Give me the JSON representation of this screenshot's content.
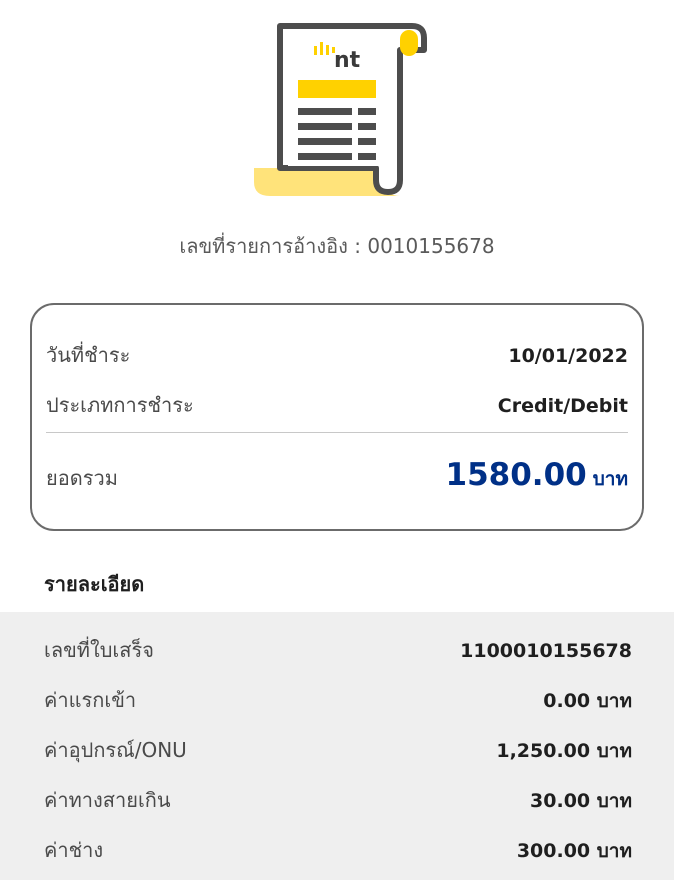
{
  "brand": {
    "logo_text": "nt"
  },
  "reference": {
    "text": "เลขที่รายการอ้างอิง : 0010155678"
  },
  "summary": {
    "payment_date_label": "วันที่ชำระ",
    "payment_date_value": "10/01/2022",
    "payment_type_label": "ประเภทการชำระ",
    "payment_type_value": "Credit/Debit",
    "total_label": "ยอดรวม",
    "total_value": "1580.00",
    "total_unit": "บาท"
  },
  "details": {
    "title": "รายละเอียด",
    "rows": [
      {
        "label": "เลขที่ใบเสร็จ",
        "value": "1100010155678"
      },
      {
        "label": "ค่าแรกเข้า",
        "value": "0.00 บาท"
      },
      {
        "label": "ค่าอุปกรณ์/ONU",
        "value": "1,250.00 บาท"
      },
      {
        "label": "ค่าทางสายเกิน",
        "value": "30.00 บาท"
      },
      {
        "label": "ค่าช่าง",
        "value": "300.00 บาท"
      }
    ]
  },
  "colors": {
    "accent_yellow": "#FFD100",
    "total_blue": "#003087",
    "icon_gray": "#4D4D4D"
  }
}
